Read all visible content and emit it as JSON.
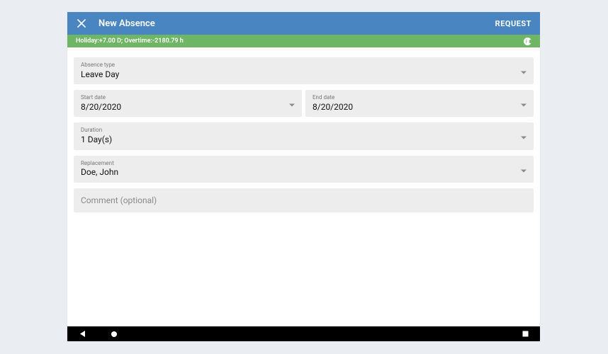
{
  "header": {
    "title": "New Absence",
    "request_label": "REQUEST"
  },
  "info_bar": {
    "text": "Holiday:+7.00 D; Overtime:-2180.79 h"
  },
  "fields": {
    "absence_type": {
      "label": "Absence type",
      "value": "Leave Day"
    },
    "start_date": {
      "label": "Start date",
      "value": "8/20/2020"
    },
    "end_date": {
      "label": "End date",
      "value": "8/20/2020"
    },
    "duration": {
      "label": "Duration",
      "value": "1 Day(s)"
    },
    "replacement": {
      "label": "Replacement",
      "value": "Doe, John"
    },
    "comment": {
      "placeholder": "Comment (optional)"
    }
  }
}
